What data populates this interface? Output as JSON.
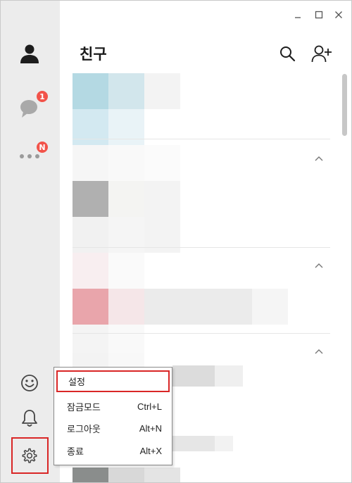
{
  "header": {
    "title": "친구"
  },
  "sidebar": {
    "items": [
      {
        "name": "friends",
        "icon": "person-icon"
      },
      {
        "name": "chats",
        "icon": "chat-bubble-icon",
        "badge": "1"
      },
      {
        "name": "more",
        "icon": "more-dots-icon",
        "badge": "N"
      },
      {
        "name": "emoticon",
        "icon": "smiley-icon"
      },
      {
        "name": "notifications",
        "icon": "bell-icon"
      },
      {
        "name": "settings",
        "icon": "gear-icon"
      }
    ]
  },
  "window_controls": {
    "minimize": "minimize-icon",
    "maximize": "maximize-icon",
    "close": "close-icon"
  },
  "context_menu": {
    "items": [
      {
        "label": "설정",
        "shortcut": ""
      },
      {
        "label": "잠금모드",
        "shortcut": "Ctrl+L"
      },
      {
        "label": "로그아웃",
        "shortcut": "Alt+N"
      },
      {
        "label": "종료",
        "shortcut": "Alt+X"
      }
    ]
  },
  "colors": {
    "sidebar_bg": "#ececec",
    "badge": "#f2534a",
    "highlight": "#d92626"
  }
}
